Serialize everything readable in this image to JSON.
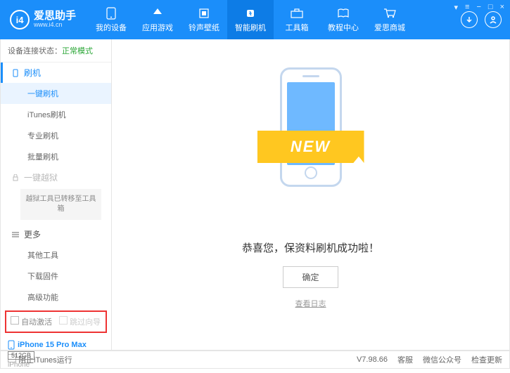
{
  "app": {
    "title": "爱思助手",
    "url": "www.i4.cn",
    "logo_letter": "i4"
  },
  "nav": [
    {
      "label": "我的设备"
    },
    {
      "label": "应用游戏"
    },
    {
      "label": "铃声壁纸"
    },
    {
      "label": "智能刷机"
    },
    {
      "label": "工具箱"
    },
    {
      "label": "教程中心"
    },
    {
      "label": "爱思商城"
    }
  ],
  "sidebar": {
    "status_label": "设备连接状态：",
    "status_value": "正常模式",
    "group_flash": "刷机",
    "items_flash": [
      {
        "label": "一键刷机"
      },
      {
        "label": "iTunes刷机"
      },
      {
        "label": "专业刷机"
      },
      {
        "label": "批量刷机"
      }
    ],
    "group_jailbreak": "一键越狱",
    "jailbreak_note": "越狱工具已转移至工具箱",
    "group_more": "更多",
    "items_more": [
      {
        "label": "其他工具"
      },
      {
        "label": "下载固件"
      },
      {
        "label": "高级功能"
      }
    ],
    "cb_auto_activate": "自动激活",
    "cb_skip_guide": "跳过向导",
    "device_name": "iPhone 15 Pro Max",
    "device_storage": "512GB",
    "device_type": "iPhone"
  },
  "main": {
    "ribbon": "NEW",
    "success": "恭喜您，保资料刷机成功啦！",
    "ok": "确定",
    "log_link": "查看日志"
  },
  "footer": {
    "block_itunes": "阻止iTunes运行",
    "version": "V7.98.66",
    "links": [
      "客服",
      "微信公众号",
      "检查更新"
    ]
  }
}
